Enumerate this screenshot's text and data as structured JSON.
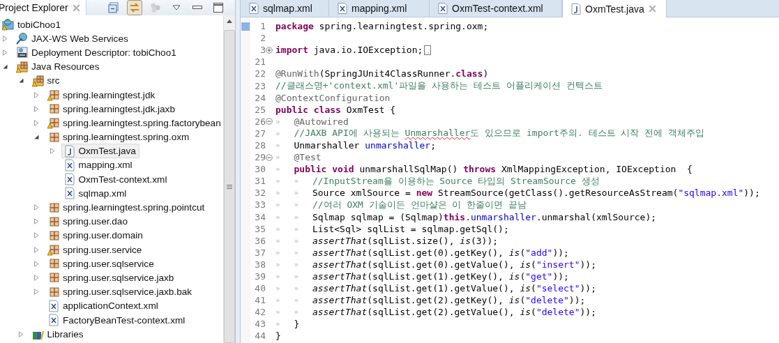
{
  "explorer": {
    "title": "Project Explorer",
    "toolbar": [
      {
        "kind": "collapse-all",
        "pressed": false,
        "disabled": false
      },
      {
        "kind": "link",
        "pressed": true,
        "disabled": false
      },
      {
        "kind": "filters",
        "pressed": false,
        "disabled": true
      },
      {
        "kind": "view-menu",
        "pressed": false,
        "disabled": false
      },
      {
        "kind": "minimize",
        "pressed": false,
        "disabled": false
      },
      {
        "kind": "maximize",
        "pressed": false,
        "disabled": false
      }
    ],
    "tree": [
      {
        "label": "tobiChoo1",
        "kind": "project",
        "warning": true,
        "selected": false,
        "children": [
          {
            "label": "JAX-WS Web Services",
            "kind": "webservices",
            "warning": false,
            "expanded": false,
            "selected": false
          },
          {
            "label": "Deployment Descriptor: tobiChoo1",
            "kind": "descriptor",
            "warning": false,
            "expanded": false,
            "selected": false
          },
          {
            "label": "Java Resources",
            "kind": "resources",
            "warning": true,
            "expanded": true,
            "selected": false,
            "children": [
              {
                "label": "src",
                "kind": "source-folder",
                "warning": true,
                "expanded": true,
                "selected": false,
                "children": [
                  {
                    "label": "spring.learningtest.jdk",
                    "kind": "package",
                    "warning": true,
                    "expanded": false,
                    "selected": false
                  },
                  {
                    "label": "spring.learningtest.jdk.jaxb",
                    "kind": "package",
                    "warning": false,
                    "expanded": false,
                    "selected": false
                  },
                  {
                    "label": "spring.learningtest.spring.factorybean",
                    "kind": "package",
                    "warning": true,
                    "expanded": false,
                    "selected": false
                  },
                  {
                    "label": "spring.learningtest.spring.oxm",
                    "kind": "package",
                    "warning": false,
                    "expanded": true,
                    "selected": false,
                    "children": [
                      {
                        "label": "OxmTest.java",
                        "kind": "java",
                        "warning": false,
                        "expanded": false,
                        "selected": true
                      },
                      {
                        "label": "mapping.xml",
                        "kind": "xml",
                        "warning": false,
                        "selected": false
                      },
                      {
                        "label": "OxmTest-context.xml",
                        "kind": "xml",
                        "warning": false,
                        "selected": false
                      },
                      {
                        "label": "sqlmap.xml",
                        "kind": "xml",
                        "warning": false,
                        "selected": false
                      }
                    ]
                  },
                  {
                    "label": "spring.learningtest.spring.pointcut",
                    "kind": "package",
                    "warning": false,
                    "expanded": false,
                    "selected": false
                  },
                  {
                    "label": "spring.user.dao",
                    "kind": "package",
                    "warning": false,
                    "expanded": false,
                    "selected": false
                  },
                  {
                    "label": "spring.user.domain",
                    "kind": "package",
                    "warning": false,
                    "expanded": false,
                    "selected": false
                  },
                  {
                    "label": "spring.user.service",
                    "kind": "package",
                    "warning": true,
                    "expanded": false,
                    "selected": false
                  },
                  {
                    "label": "spring.user.sqlservice",
                    "kind": "package",
                    "warning": false,
                    "expanded": false,
                    "selected": false
                  },
                  {
                    "label": "spring.user.sqlservice.jaxb",
                    "kind": "package",
                    "warning": false,
                    "expanded": false,
                    "selected": false
                  },
                  {
                    "label": "spring.user.sqlservice.jaxb.bak",
                    "kind": "package",
                    "warning": false,
                    "expanded": false,
                    "selected": false
                  },
                  {
                    "label": "applicationContext.xml",
                    "kind": "xml",
                    "warning": false,
                    "selected": false
                  },
                  {
                    "label": "FactoryBeanTest-context.xml",
                    "kind": "xml",
                    "warning": false,
                    "selected": false
                  }
                ]
              },
              {
                "label": "Libraries",
                "kind": "libraries",
                "warning": false,
                "expanded": false,
                "selected": false
              }
            ]
          }
        ]
      }
    ]
  },
  "editor": {
    "tabs": [
      {
        "label": "sqlmap.xml",
        "kind": "xml",
        "selected": false
      },
      {
        "label": "mapping.xml",
        "kind": "xml",
        "selected": false
      },
      {
        "label": "OxmTest-context.xml",
        "kind": "xml",
        "selected": false
      },
      {
        "label": "OxmTest.java",
        "kind": "java",
        "selected": true
      }
    ],
    "lines": [
      {
        "num": "1",
        "marked": true,
        "tokens": [
          {
            "kind": "kw",
            "text": "package"
          },
          {
            "kind": "plain",
            "text": " spring.learningtest.spring.oxm;"
          }
        ]
      },
      {
        "num": "2"
      },
      {
        "num": "3",
        "folded": true,
        "tokens": [
          {
            "kind": "kw",
            "text": "import"
          },
          {
            "kind": "plain",
            "text": " java.io.IOException;"
          }
        ]
      },
      {
        "num": "21"
      },
      {
        "num": "22",
        "tokens": [
          {
            "kind": "ann",
            "text": "@RunWith"
          },
          {
            "kind": "plain",
            "text": "(SpringJUnit4ClassRunner."
          },
          {
            "kind": "kw",
            "text": "class"
          },
          {
            "kind": "plain",
            "text": ")"
          }
        ]
      },
      {
        "num": "23",
        "tokens": [
          {
            "kind": "com",
            "text": "//클래스명+'context.xml'파일을 사용하는 테스트 어플리케이션 컨텍스트"
          }
        ]
      },
      {
        "num": "24",
        "tokens": [
          {
            "kind": "ann",
            "text": "@ContextConfiguration"
          }
        ]
      },
      {
        "num": "25",
        "tokens": [
          {
            "kind": "kw",
            "text": "public class"
          },
          {
            "kind": "plain",
            "text": " OxmTest {"
          }
        ]
      },
      {
        "num": "26",
        "folded": false,
        "tabs": [
          "»"
        ],
        "tokens": [
          {
            "kind": "ann",
            "text": "@Autowired"
          }
        ]
      },
      {
        "num": "27",
        "tabs": [
          "»"
        ],
        "tokens": [
          {
            "kind": "com",
            "text": "//JAXB API에 사용되는 "
          },
          {
            "kind": "com-error",
            "text": "Unmarshaller"
          },
          {
            "kind": "com",
            "text": "도 있으므로 import주의. 테스트 시작 전에 객체주입"
          }
        ]
      },
      {
        "num": "28",
        "tabs": [
          "»"
        ],
        "tokens": [
          {
            "kind": "plain",
            "text": "Unmarshaller "
          },
          {
            "kind": "field",
            "text": "unmarshaller"
          },
          {
            "kind": "plain",
            "text": ";"
          }
        ]
      },
      {
        "num": "29",
        "folded": false,
        "tabs": [
          "»"
        ],
        "tokens": [
          {
            "kind": "ann",
            "text": "@Test"
          }
        ]
      },
      {
        "num": "30",
        "tabs": [
          "»"
        ],
        "tokens": [
          {
            "kind": "kw",
            "text": "public void"
          },
          {
            "kind": "plain",
            "text": " unmarshallSqlMap() "
          },
          {
            "kind": "kw",
            "text": "throws"
          },
          {
            "kind": "plain",
            "text": " XmlMappingException, IOException  {"
          }
        ]
      },
      {
        "num": "31",
        "tabs": [
          "»",
          "»"
        ],
        "tokens": [
          {
            "kind": "com",
            "text": "//InputStream을 이용하는 Source 타입의 StreamSource 생성"
          }
        ]
      },
      {
        "num": "32",
        "tabs": [
          "»",
          "»"
        ],
        "tokens": [
          {
            "kind": "plain",
            "text": "Source xmlSource = "
          },
          {
            "kind": "kw",
            "text": "new"
          },
          {
            "kind": "plain",
            "text": " StreamSource(getClass().getResourceAsStream("
          },
          {
            "kind": "str",
            "text": "\"sqlmap.xml\""
          },
          {
            "kind": "plain",
            "text": "));"
          }
        ]
      },
      {
        "num": "33",
        "tabs": [
          "»",
          "»"
        ],
        "tokens": [
          {
            "kind": "com",
            "text": "//여러 OXM 기술이든 언마샬은 이 한줄이면 끝남"
          }
        ]
      },
      {
        "num": "34",
        "tabs": [
          "»",
          "»"
        ],
        "tokens": [
          {
            "kind": "plain",
            "text": "Sqlmap sqlmap = (Sqlmap)"
          },
          {
            "kind": "kw",
            "text": "this"
          },
          {
            "kind": "plain",
            "text": "."
          },
          {
            "kind": "field",
            "text": "unmarshaller"
          },
          {
            "kind": "plain",
            "text": ".unmarshal(xmlSource);"
          }
        ]
      },
      {
        "num": "35",
        "tabs": [
          "»",
          "»"
        ],
        "tokens": [
          {
            "kind": "plain",
            "text": "List<Sql> sqlList = sqlmap.getSql();"
          }
        ]
      },
      {
        "num": "36",
        "tabs": [
          "»",
          "»"
        ],
        "tokens": [
          {
            "kind": "static",
            "text": "assertThat"
          },
          {
            "kind": "plain",
            "text": "(sqlList.size(), "
          },
          {
            "kind": "static",
            "text": "is"
          },
          {
            "kind": "plain",
            "text": "(3));"
          }
        ]
      },
      {
        "num": "37",
        "tabs": [
          "»",
          "»"
        ],
        "tokens": [
          {
            "kind": "static",
            "text": "assertThat"
          },
          {
            "kind": "plain",
            "text": "(sqlList.get(0).getKey(), "
          },
          {
            "kind": "static",
            "text": "is"
          },
          {
            "kind": "plain",
            "text": "("
          },
          {
            "kind": "str",
            "text": "\"add\""
          },
          {
            "kind": "plain",
            "text": "));"
          }
        ]
      },
      {
        "num": "38",
        "tabs": [
          "»",
          "»"
        ],
        "tokens": [
          {
            "kind": "static",
            "text": "assertThat"
          },
          {
            "kind": "plain",
            "text": "(sqlList.get(0).getValue(), "
          },
          {
            "kind": "static",
            "text": "is"
          },
          {
            "kind": "plain",
            "text": "("
          },
          {
            "kind": "str",
            "text": "\"insert\""
          },
          {
            "kind": "plain",
            "text": "));"
          }
        ]
      },
      {
        "num": "39",
        "tabs": [
          "»",
          "»"
        ],
        "tokens": [
          {
            "kind": "static",
            "text": "assertThat"
          },
          {
            "kind": "plain",
            "text": "(sqlList.get(1).getKey(), "
          },
          {
            "kind": "static",
            "text": "is"
          },
          {
            "kind": "plain",
            "text": "("
          },
          {
            "kind": "str",
            "text": "\"get\""
          },
          {
            "kind": "plain",
            "text": "));"
          }
        ]
      },
      {
        "num": "40",
        "tabs": [
          "»",
          "»"
        ],
        "tokens": [
          {
            "kind": "static",
            "text": "assertThat"
          },
          {
            "kind": "plain",
            "text": "(sqlList.get(1).getValue(), "
          },
          {
            "kind": "static",
            "text": "is"
          },
          {
            "kind": "plain",
            "text": "("
          },
          {
            "kind": "str",
            "text": "\"select\""
          },
          {
            "kind": "plain",
            "text": "));"
          }
        ]
      },
      {
        "num": "41",
        "tabs": [
          "»",
          "»"
        ],
        "tokens": [
          {
            "kind": "static",
            "text": "assertThat"
          },
          {
            "kind": "plain",
            "text": "(sqlList.get(2).getKey(), "
          },
          {
            "kind": "static",
            "text": "is"
          },
          {
            "kind": "plain",
            "text": "("
          },
          {
            "kind": "str",
            "text": "\"delete\""
          },
          {
            "kind": "plain",
            "text": "));"
          }
        ]
      },
      {
        "num": "42",
        "tabs": [
          "»",
          "»"
        ],
        "tokens": [
          {
            "kind": "static",
            "text": "assertThat"
          },
          {
            "kind": "plain",
            "text": "(sqlList.get(2).getValue(), "
          },
          {
            "kind": "static",
            "text": "is"
          },
          {
            "kind": "plain",
            "text": "("
          },
          {
            "kind": "str",
            "text": "\"delete\""
          },
          {
            "kind": "plain",
            "text": "));"
          }
        ]
      },
      {
        "num": "43",
        "tabs": [
          "»"
        ],
        "tokens": [
          {
            "kind": "plain",
            "text": "}"
          }
        ]
      },
      {
        "num": "44",
        "tokens": [
          {
            "kind": "plain",
            "text": "}"
          }
        ]
      }
    ]
  }
}
